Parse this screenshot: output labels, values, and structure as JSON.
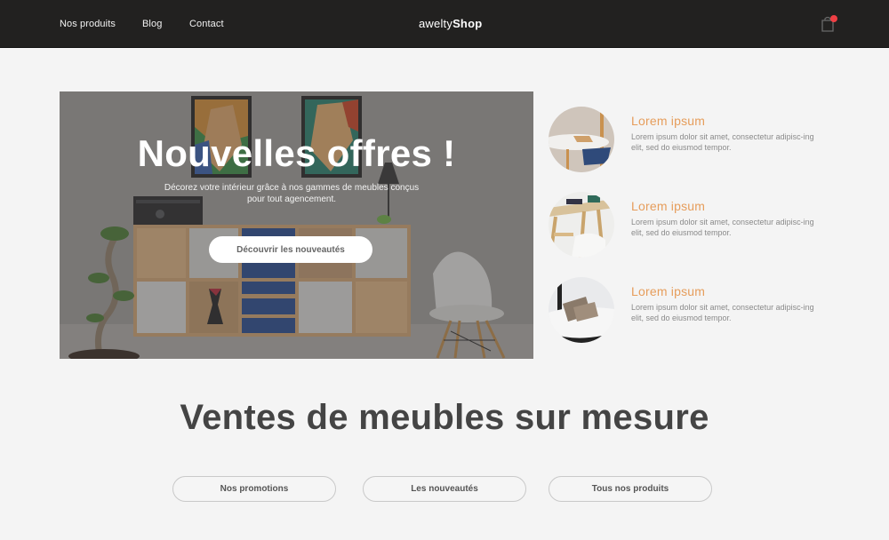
{
  "header": {
    "nav": [
      "Nos produits",
      "Blog",
      "Contact"
    ],
    "brand_light": "awelty",
    "brand_bold": "Shop",
    "cart_icon": "shopping-bag-icon",
    "cart_badge_color": "#ef3f44"
  },
  "hero": {
    "title": "Nouvelles offres !",
    "subtitle": "Décorez votre intérieur grâce à nos gammes de meubles conçus pour tout agencement.",
    "cta": "Découvrir les nouveautés"
  },
  "features": [
    {
      "title": "Lorem ipsum",
      "text": "Lorem ipsum dolor sit amet, consectetur adipisc-ing elit, sed do eiusmod tempor.",
      "image": "chair-table-photo"
    },
    {
      "title": "Lorem ipsum",
      "text": "Lorem ipsum dolor sit amet, consectetur adipisc-ing elit, sed do eiusmod tempor.",
      "image": "desk-photo"
    },
    {
      "title": "Lorem ipsum",
      "text": "Lorem ipsum dolor sit amet, consectetur adipisc-ing elit, sed do eiusmod tempor.",
      "image": "sofa-cushions-photo"
    }
  ],
  "section": {
    "title": "Ventes de meubles sur mesure",
    "buttons": [
      "Nos promotions",
      "Les nouveautés",
      "Tous nos produits"
    ]
  },
  "colors": {
    "header_bg": "#222120",
    "page_bg": "#f4f4f4",
    "accent": "#e69d5b",
    "heading": "#444444"
  }
}
